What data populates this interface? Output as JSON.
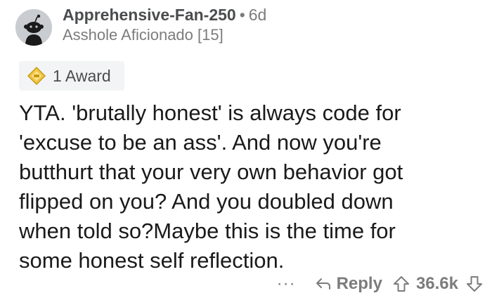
{
  "comment": {
    "username": "Apprehensive-Fan-250",
    "separator": "•",
    "age": "6d",
    "flair": "Asshole Aficionado [15]",
    "award_label": "1 Award",
    "body": "YTA. 'brutally honest' is always code for\n'excuse to be an ass'.  And now you're\nbutthurt that your very own behavior got\nflipped on you? And you doubled down\nwhen told so?Maybe this is the time for\nsome honest self reflection.",
    "actions": {
      "more": "···",
      "reply_label": "Reply",
      "score": "36.6k"
    }
  },
  "icons": {
    "avatar": "snoo-avatar-icon",
    "award": "award-icon",
    "reply": "reply-arrow-icon",
    "upvote": "upvote-arrow-icon",
    "downvote": "downvote-arrow-icon"
  },
  "colors": {
    "text_primary": "#1a1a1b",
    "text_meta": "#7c7c7c",
    "award_bg": "#f3f4f5",
    "avatar_bg": "#c9cdd1"
  }
}
